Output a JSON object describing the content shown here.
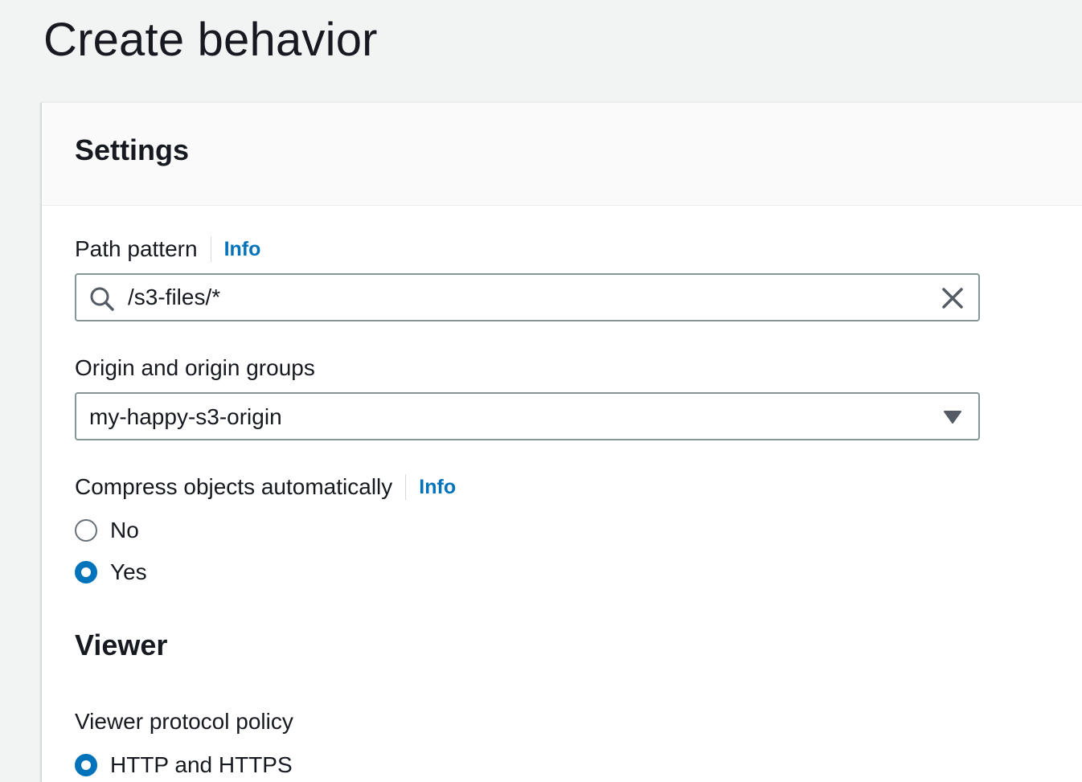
{
  "page": {
    "title": "Create behavior"
  },
  "settings": {
    "title": "Settings",
    "path_pattern": {
      "label": "Path pattern",
      "info": "Info",
      "value": "/s3-files/*"
    },
    "origin": {
      "label": "Origin and origin groups",
      "selected": "my-happy-s3-origin"
    },
    "compress": {
      "label": "Compress objects automatically",
      "info": "Info",
      "options": [
        {
          "label": "No",
          "checked": false
        },
        {
          "label": "Yes",
          "checked": true
        }
      ]
    }
  },
  "viewer": {
    "title": "Viewer",
    "protocol_policy": {
      "label": "Viewer protocol policy",
      "options": [
        {
          "label": "HTTP and HTTPS",
          "checked": true
        }
      ]
    }
  },
  "colors": {
    "accent": "#0073bb",
    "text": "#16191f",
    "border": "#879596",
    "background": "#f2f3f3"
  }
}
